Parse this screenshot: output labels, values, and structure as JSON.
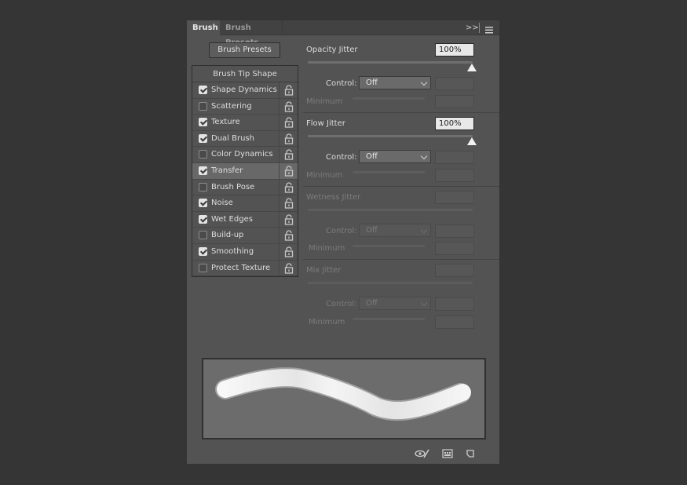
{
  "tabs": {
    "active": "Brush",
    "inactive": "Brush Presets",
    "overflow_glyph": ">>",
    "menu_icon": "menu-icon"
  },
  "presets_button": "Brush Presets",
  "list": {
    "header": "Brush Tip Shape",
    "items": [
      {
        "label": "Shape Dynamics",
        "checked": true
      },
      {
        "label": "Scattering",
        "checked": false
      },
      {
        "label": "Texture",
        "checked": true
      },
      {
        "label": "Dual Brush",
        "checked": true
      },
      {
        "label": "Color Dynamics",
        "checked": false
      },
      {
        "label": "Transfer",
        "checked": true,
        "selected": true
      },
      {
        "label": "Brush Pose",
        "checked": false
      },
      {
        "label": "Noise",
        "checked": true
      },
      {
        "label": "Wet Edges",
        "checked": true
      },
      {
        "label": "Build-up",
        "checked": false
      },
      {
        "label": "Smoothing",
        "checked": true
      },
      {
        "label": "Protect Texture",
        "checked": false
      }
    ]
  },
  "transfer": {
    "opacity": {
      "label": "Opacity Jitter",
      "value": "100%",
      "control_label": "Control:",
      "control_value": "Off",
      "minimum_label": "Minimum"
    },
    "flow": {
      "label": "Flow Jitter",
      "value": "100%",
      "control_label": "Control:",
      "control_value": "Off",
      "minimum_label": "Minimum"
    },
    "wetness": {
      "label": "Wetness Jitter",
      "control_label": "Control:",
      "control_value": "Off",
      "minimum_label": "Minimum"
    },
    "mix": {
      "label": "Mix Jitter",
      "control_label": "Control:",
      "control_value": "Off",
      "minimum_label": "Minimum"
    }
  },
  "bottom_icons": [
    "eye-brush-icon",
    "new-preset-icon",
    "create-new-icon"
  ],
  "colors": {
    "panel": "#535353",
    "background": "#353535",
    "selected_row": "#686868"
  }
}
